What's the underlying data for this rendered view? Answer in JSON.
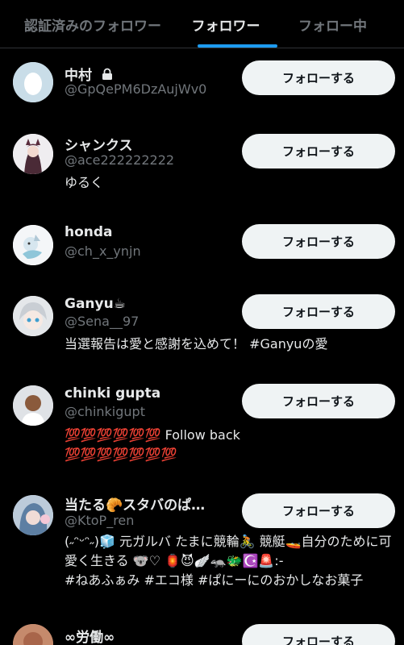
{
  "tabs": [
    {
      "label": "認証済みのフォロワー"
    },
    {
      "label": "フォロワー"
    },
    {
      "label": "フォロー中"
    }
  ],
  "follow_label": "フォローする",
  "accent_color": "#1d9bf0",
  "users": [
    {
      "name": "中村",
      "handle": "@GpQePM6DzAujWv0",
      "bio": "",
      "protected": true
    },
    {
      "name": "シャンクス",
      "handle": "@ace222222222",
      "bio": "ゆるく"
    },
    {
      "name": "honda",
      "handle": "@ch_x_ynjn",
      "bio": ""
    },
    {
      "name": "Ganyu☕",
      "handle": "@Sena__97",
      "bio": "当選報告は愛と感謝を込めて！ #Ganyuの愛"
    },
    {
      "name": "chinki gupta",
      "handle": "@chinkigupt",
      "bio": "💯💯💯💯💯💯 Follow back\n💯💯💯💯💯💯💯"
    },
    {
      "name": "当たる🥐スタバのぱ…",
      "handle": "@KtoP_ren",
      "bio": "(˶ᵔᵕᵔ˶)🧊 元ガルバ たまに競輪🚴 競艇🚤自分のために可愛く生きる 🐨♡ 🏮😈🪽🦡🐲☪️🚨:-\n#ねあふぁみ #エコ様 #ぱにーにのおかしなお菓子"
    },
    {
      "name": "∞労働∞",
      "handle": "",
      "bio": ""
    }
  ]
}
